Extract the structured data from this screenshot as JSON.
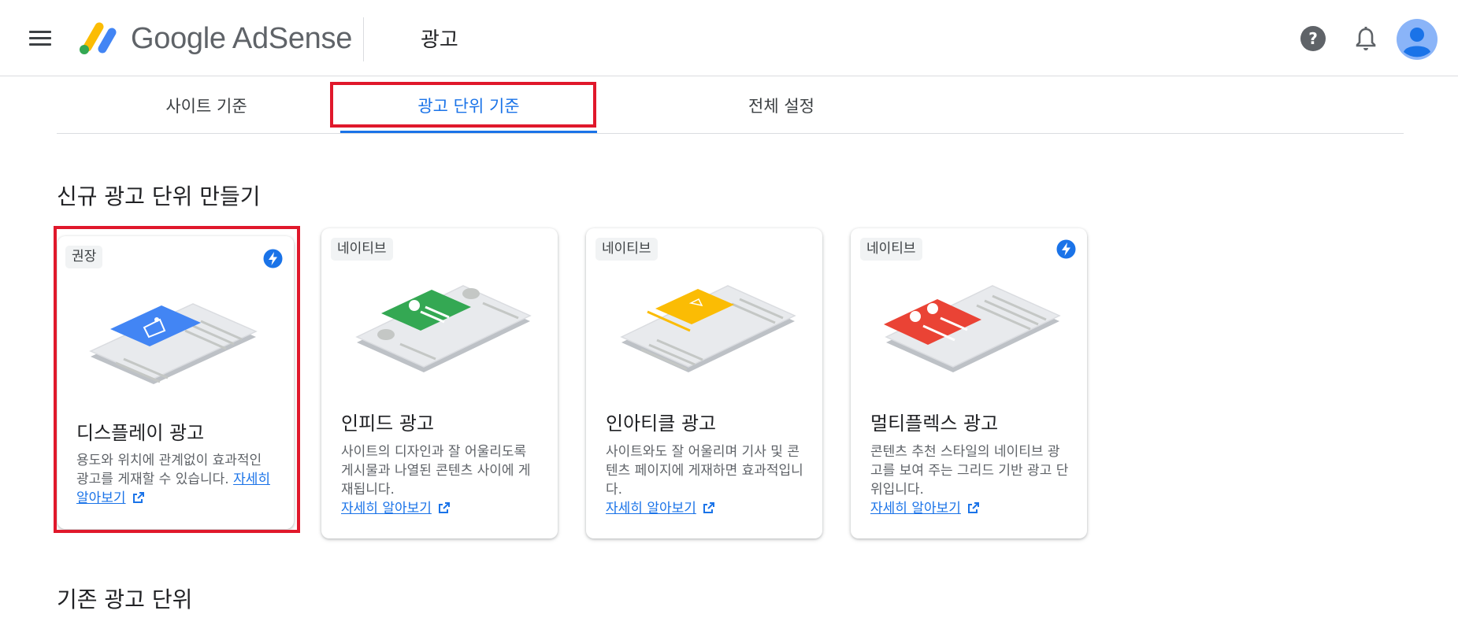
{
  "header": {
    "brand": "Google AdSense",
    "page_title": "광고"
  },
  "tabs": [
    {
      "label": "사이트 기준"
    },
    {
      "label": "광고 단위 기준",
      "selected": true
    },
    {
      "label": "전체 설정"
    }
  ],
  "sections": {
    "new_title": "신규 광고 단위 만들기",
    "existing_title": "기존 광고 단위"
  },
  "cards": [
    {
      "chip": "권장",
      "title": "디스플레이 광고",
      "desc": "용도와 위치에 관계없이 효과적인 광고를 게재할 수 있습니다.",
      "desc_before_link": "용도와 위치에 관계없이 효과적인 광고를 게재할 수 있습니다. ",
      "link": "자세히 알아보기",
      "accent": "#4285f4",
      "bolt": true
    },
    {
      "chip": "네이티브",
      "title": "인피드 광고",
      "desc": "사이트의 디자인과 잘 어울리도록 게시물과 나열된 콘텐츠 사이에 게재됩니다.",
      "link": "자세히 알아보기",
      "accent": "#34a853",
      "bolt": false
    },
    {
      "chip": "네이티브",
      "title": "인아티클 광고",
      "desc": "사이트와도 잘 어울리며 기사 및 콘텐츠 페이지에 게재하면 효과적입니다.",
      "link": "자세히 알아보기",
      "accent": "#fbbc04",
      "bolt": false
    },
    {
      "chip": "네이티브",
      "title": "멀티플렉스 광고",
      "desc": "콘텐츠 추천 스타일의 네이티브 광고를 보여 주는 그리드 기반 광고 단위입니다.",
      "link": "자세히 알아보기",
      "accent": "#ea4335",
      "bolt": true
    }
  ],
  "icons": {
    "menu": "menu-icon",
    "help": "help-icon",
    "notifications": "bell-icon",
    "account": "avatar-icon",
    "external_link": "open-in-new-icon",
    "bolt": "bolt-icon"
  },
  "colors": {
    "accent_blue": "#1a73e8",
    "highlight_red": "#e0182b",
    "logo_yellow": "#fbbc04",
    "logo_blue": "#4285f4",
    "logo_green": "#34a853"
  }
}
